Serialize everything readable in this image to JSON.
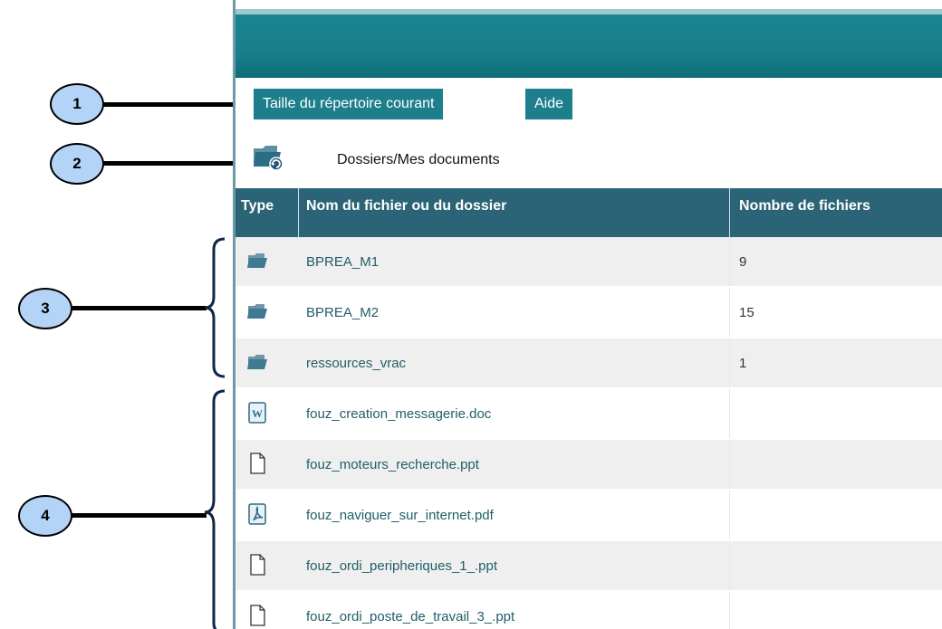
{
  "toolbar": {
    "size_button": "Taille du répertoire courant",
    "help_button": "Aide"
  },
  "breadcrumb": {
    "path": "Dossiers/Mes documents"
  },
  "table": {
    "columns": [
      "Type",
      "Nom du fichier ou du dossier",
      "Nombre de fichiers"
    ],
    "rows": [
      {
        "type": "folder",
        "name": "BPREA_M1",
        "count": "9"
      },
      {
        "type": "folder",
        "name": "BPREA_M2",
        "count": "15"
      },
      {
        "type": "folder",
        "name": "ressources_vrac",
        "count": "1"
      },
      {
        "type": "word",
        "name": "fouz_creation_messagerie.doc",
        "count": ""
      },
      {
        "type": "file",
        "name": "fouz_moteurs_recherche.ppt",
        "count": ""
      },
      {
        "type": "pdf",
        "name": "fouz_naviguer_sur_internet.pdf",
        "count": ""
      },
      {
        "type": "file",
        "name": "fouz_ordi_peripheriques_1_.ppt",
        "count": ""
      },
      {
        "type": "file",
        "name": "fouz_ordi_poste_de_travail_3_.ppt",
        "count": ""
      }
    ]
  },
  "callouts": [
    "1",
    "2",
    "3",
    "4"
  ],
  "colors": {
    "banner": "#1b7f8b",
    "button": "#1e7f8c",
    "header": "#2b6476",
    "link": "#1f5e68",
    "callout": "#b3d3f7"
  }
}
